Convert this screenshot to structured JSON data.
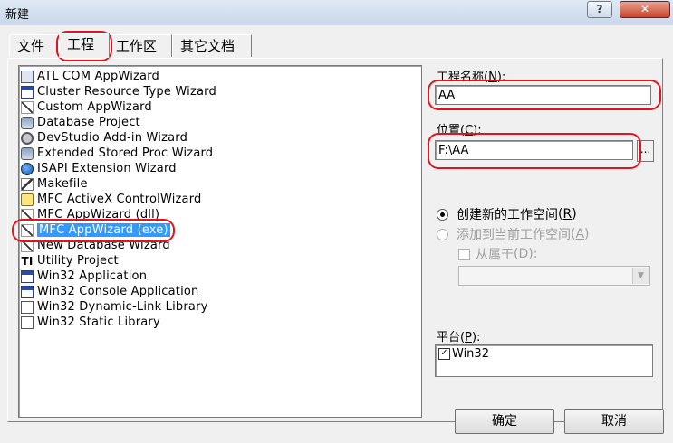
{
  "window": {
    "title": "新建",
    "help_label": "?",
    "close_label": "✕"
  },
  "tabs": [
    {
      "label": "文件",
      "active": false
    },
    {
      "label": "工程",
      "active": true
    },
    {
      "label": "工作区",
      "active": false
    },
    {
      "label": "其它文档",
      "active": false
    }
  ],
  "project_types": [
    {
      "label": "ATL COM AppWizard",
      "icon": "atl-com-icon"
    },
    {
      "label": "Cluster Resource Type Wizard",
      "icon": "cluster-resource-icon"
    },
    {
      "label": "Custom AppWizard",
      "icon": "custom-wizard-icon"
    },
    {
      "label": "Database Project",
      "icon": "database-icon"
    },
    {
      "label": "DevStudio Add-in Wizard",
      "icon": "addin-wizard-icon"
    },
    {
      "label": "Extended Stored Proc Wizard",
      "icon": "stored-proc-icon"
    },
    {
      "label": "ISAPI Extension Wizard",
      "icon": "globe-icon"
    },
    {
      "label": "Makefile",
      "icon": "makefile-icon"
    },
    {
      "label": "MFC ActiveX ControlWizard",
      "icon": "activex-key-icon"
    },
    {
      "label": "MFC AppWizard (dll)",
      "icon": "mfc-dll-icon"
    },
    {
      "label": "MFC AppWizard (exe)",
      "icon": "mfc-exe-icon",
      "selected": true
    },
    {
      "label": "New Database Wizard",
      "icon": "new-database-icon"
    },
    {
      "label": "Utility Project",
      "icon": "utility-icon"
    },
    {
      "label": "Win32 Application",
      "icon": "win32-app-icon"
    },
    {
      "label": "Win32 Console Application",
      "icon": "console-app-icon"
    },
    {
      "label": "Win32 Dynamic-Link Library",
      "icon": "dll-icon"
    },
    {
      "label": "Win32 Static Library",
      "icon": "static-lib-icon"
    }
  ],
  "project_name": {
    "label": "工程名称",
    "mnemonic": "(N):",
    "mnemonic_key": "N",
    "value": "AA"
  },
  "location": {
    "label": "位置",
    "mnemonic_key": "C",
    "value": "F:\\AA",
    "browse_label": "..."
  },
  "workspace": {
    "create_new": {
      "label": "创建新的工作空间",
      "key": "R",
      "checked": true
    },
    "add_to_current": {
      "label": "添加到当前工作空间",
      "key": "A",
      "checked": false,
      "disabled": true
    },
    "dependency": {
      "label": "从属于",
      "key": "D",
      "checked": false,
      "disabled": true
    },
    "dependency_value": ""
  },
  "platforms": {
    "label": "平台",
    "key": "P",
    "items": [
      {
        "label": "Win32",
        "checked": true
      }
    ]
  },
  "buttons": {
    "ok": "确定",
    "cancel": "取消"
  }
}
